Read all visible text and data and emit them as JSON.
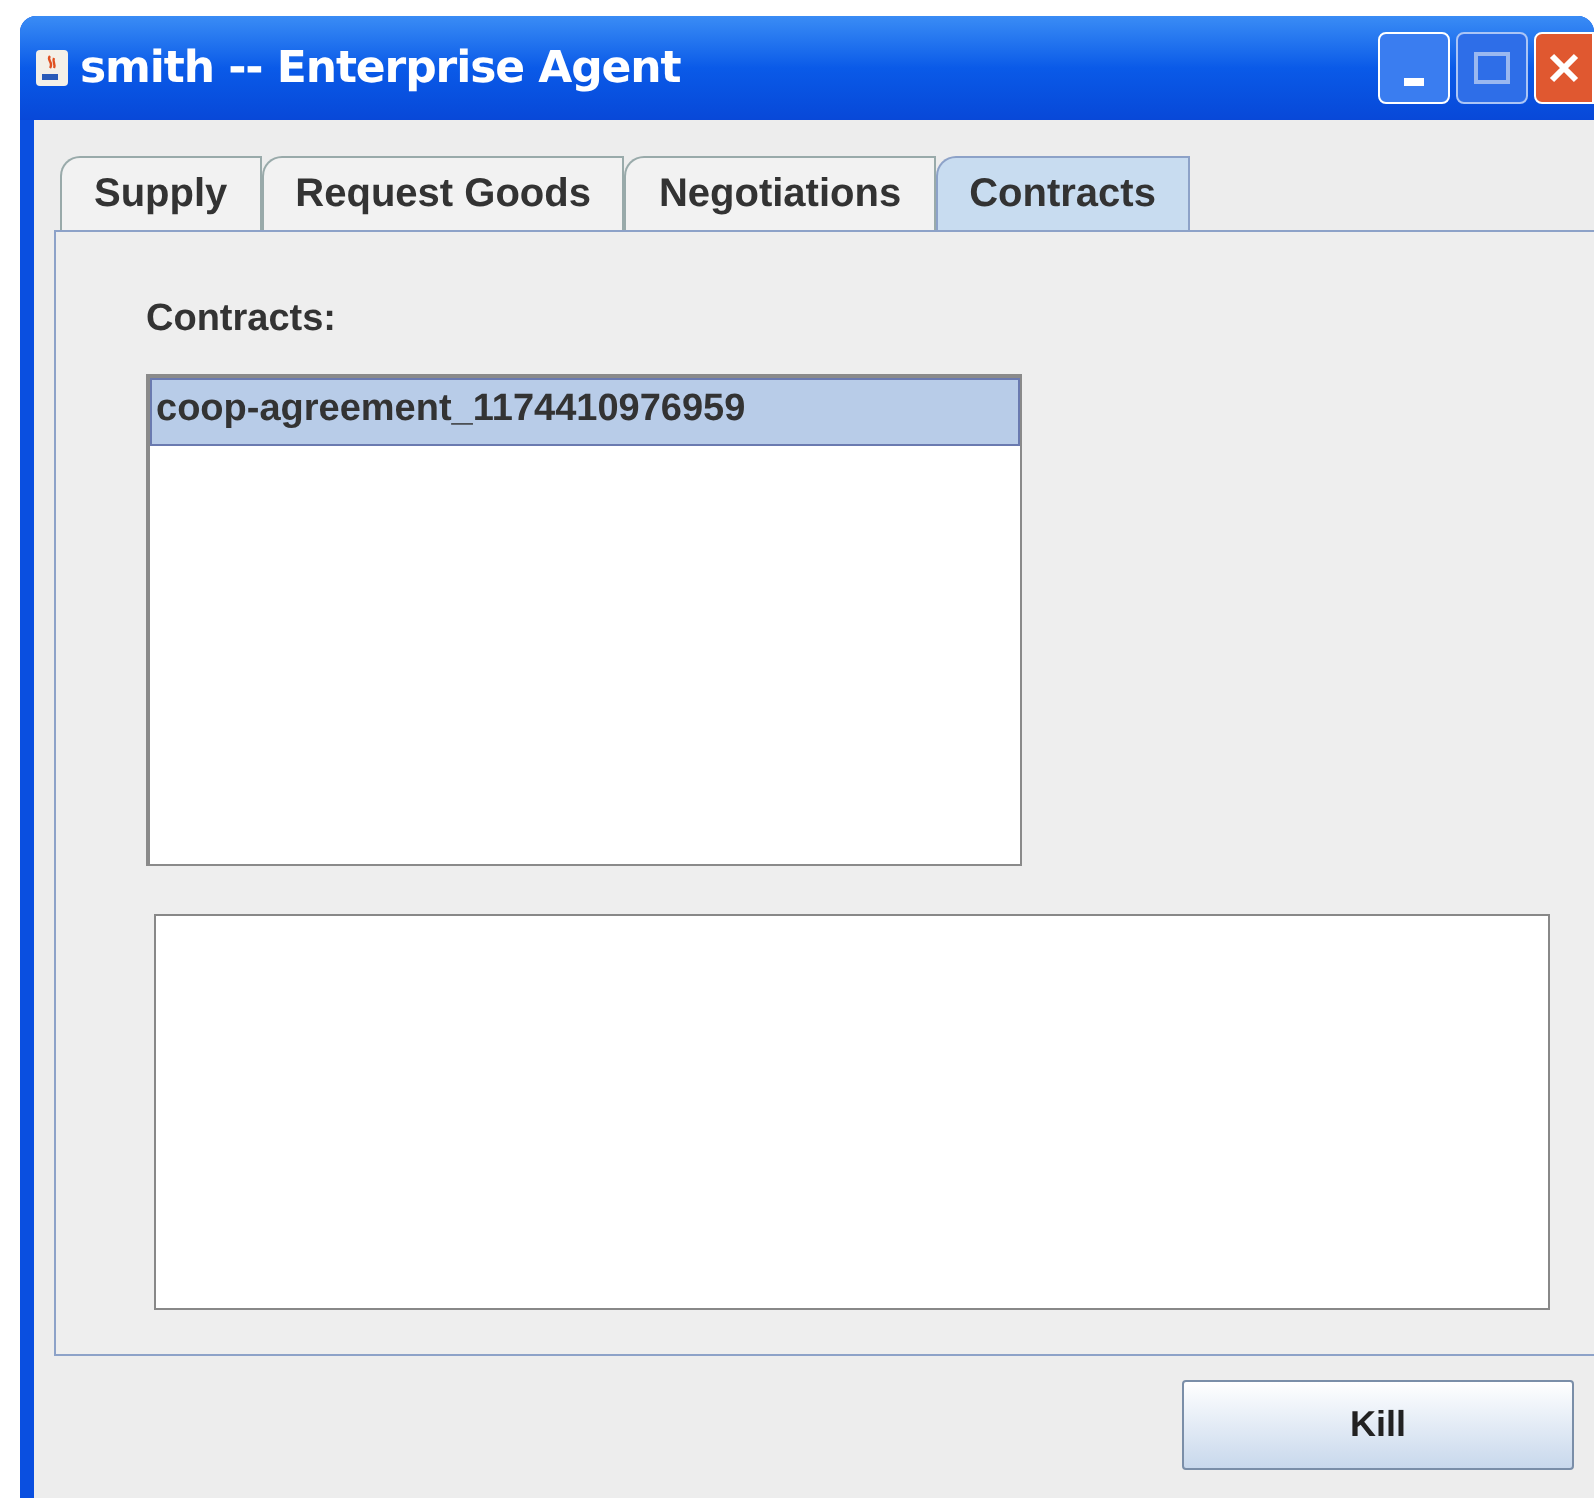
{
  "window": {
    "title": "smith -- Enterprise Agent"
  },
  "tabs": [
    {
      "label": "Supply",
      "selected": false
    },
    {
      "label": "Request Goods",
      "selected": false
    },
    {
      "label": "Negotiations",
      "selected": false
    },
    {
      "label": "Contracts",
      "selected": true
    }
  ],
  "contracts": {
    "label": "Contracts:",
    "items": [
      {
        "text": "coop-agreement_1174410976959",
        "selected": true
      }
    ]
  },
  "buttons": [
    "Kill"
  ]
}
